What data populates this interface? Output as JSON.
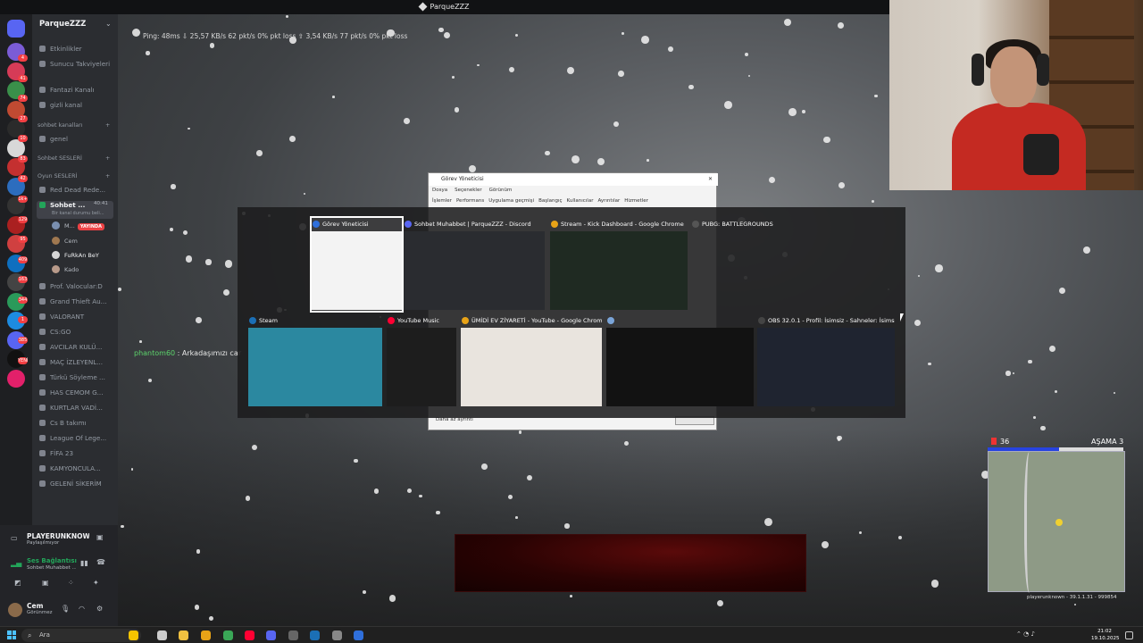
{
  "top_title": "ParqueZZZ",
  "net_stats": "Ping: 48ms   ⇩ 25,57 KB/s   62 pkt/s   0% pkt loss   ⇧ 3,54 KB/s   77 pkt/s   0% pkt loss",
  "discord": {
    "server_name": "ParqueZZZ",
    "top_items": [
      "Etkinlikler",
      "Sunucu Takviyeleri"
    ],
    "channels_a": [
      "Fantazi Kanalı",
      "gizli kanal"
    ],
    "cat_text": "sohbet kanalları",
    "text_channels": [
      "genel"
    ],
    "cat_voice": "Sohbet SESLERİ",
    "cat_games": "Oyun SESLERİ",
    "voice_channels": [
      "Red Dead Rede..."
    ],
    "active_channel": "Sohbet ...",
    "active_time": "40:41",
    "active_sub": "Bir kanal durumu beli...",
    "members": [
      {
        "name": "M...",
        "live": "YAYINDA"
      },
      {
        "name": "Cem"
      },
      {
        "name": "FuRkAn BeY"
      },
      {
        "name": "Kado"
      }
    ],
    "more_channels": [
      "Prof. Valocular:D",
      "Grand Thieft Au...",
      "VALORANT",
      "CS:GO",
      "AVCILAR KULÜ...",
      "MAÇ İZLEYENL...",
      "Türkü Söyleme ...",
      "HAS CEMOM G...",
      "KURTLAR VADİ...",
      "Cs B takımı",
      "League Of Lege...",
      "FİFA 23",
      "KAMYONCULA...",
      "GELENİ SİKERİM"
    ],
    "guild_badges": [
      "4",
      "41",
      "74",
      "27",
      "10",
      "83",
      "42",
      "1k+",
      "129",
      "95",
      "409",
      "163",
      "344",
      "1",
      "385",
      "YENİ"
    ],
    "game_name": "PLAYERUNKNOW...",
    "game_sub": "Paylaşılmıyor",
    "voice_status": "Ses Bağlantısı",
    "voice_channel": "Sohbet Muhabbet ...",
    "user_name": "Cem",
    "user_status": "Görünmez"
  },
  "chat": {
    "user": "phantom60",
    "message": ": Arkadaşımızı car"
  },
  "minimap": {
    "alive": "36",
    "phase": "AŞAMA 3",
    "footer": "playerunknown - 39.1.1.31 - 999854"
  },
  "task_manager": {
    "title": "Görev Yöneticisi",
    "menu": [
      "Dosya",
      "Seçenekler",
      "Görünüm"
    ],
    "tabs": [
      "İşlemler",
      "Performans",
      "Uygulama geçmişi",
      "Başlangıç",
      "Kullanıcılar",
      "Ayrıntılar",
      "Hizmetler"
    ],
    "footer": "Daha az ayrıntı"
  },
  "alt_tab": [
    {
      "title": "Görev Yöneticisi",
      "icon": "task-manager-icon",
      "color": "#2f6fdb"
    },
    {
      "title": "Sohbet Muhabbet | ParqueZZZ - Discord",
      "icon": "discord-icon",
      "color": "#5865f2"
    },
    {
      "title": "Stream - Kick Dashboard - Google Chrome",
      "icon": "chrome-icon",
      "color": "#e8a317"
    },
    {
      "title": "PUBG: BATTLEGROUNDS",
      "icon": "pubg-icon",
      "color": "#555555"
    },
    {
      "title": "Steam",
      "icon": "steam-icon",
      "color": "#1b6fb5"
    },
    {
      "title": "YouTube Music",
      "icon": "youtube-music-icon",
      "color": "#ff0033"
    },
    {
      "title": "ÜMİDİ EV ZİYARETİ - YouTube - Google Chrome",
      "icon": "chrome-icon",
      "color": "#e8a317"
    },
    {
      "title": "",
      "icon": "app-icon",
      "color": "#7aa4d8"
    },
    {
      "title": "OBS 32.0.1 - Profil: İsimsiz - Sahneler: İsimsiz",
      "icon": "obs-icon",
      "color": "#444444"
    }
  ],
  "taskbar": {
    "search": "Ara",
    "time": "21:02",
    "date": "19.10.2025"
  }
}
